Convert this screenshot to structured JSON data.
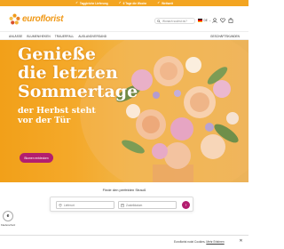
{
  "promo": {
    "items": [
      "Taggleiche Lieferung",
      "6 Tage die Woche",
      "Weltweit"
    ]
  },
  "header": {
    "logo_text": "euroflorist",
    "search_placeholder": "Wonach suchst du?",
    "language": "DE"
  },
  "nav": {
    "items": [
      "ANLÄSSE",
      "BLUMEN/HEKEN",
      "TRAUERFALL",
      "AUSLANDVERSAND"
    ],
    "right": "GESCHÄFTSKUNDEN"
  },
  "hero": {
    "title_lines": [
      "Genieße",
      "die letzten",
      "Sommertage"
    ],
    "subtitle_lines": [
      "der Herbst steht",
      "vor der Tür"
    ],
    "cta": "Blumen entdecken"
  },
  "delivery": {
    "title": "Finde den perfekten Strauß",
    "place_placeholder": "Lieferort",
    "date_placeholder": "Zustelldatum",
    "submit_symbol": "›"
  },
  "badge": {
    "symbol": "e",
    "label": "Käuferschutz"
  },
  "cookie": {
    "text": "Euroflorist nutzt Cookies.",
    "link": "Mehr Erfahren"
  },
  "colors": {
    "brand_orange": "#f09a1a",
    "accent_magenta": "#b31e6f",
    "hero_background": "#f2a019"
  }
}
